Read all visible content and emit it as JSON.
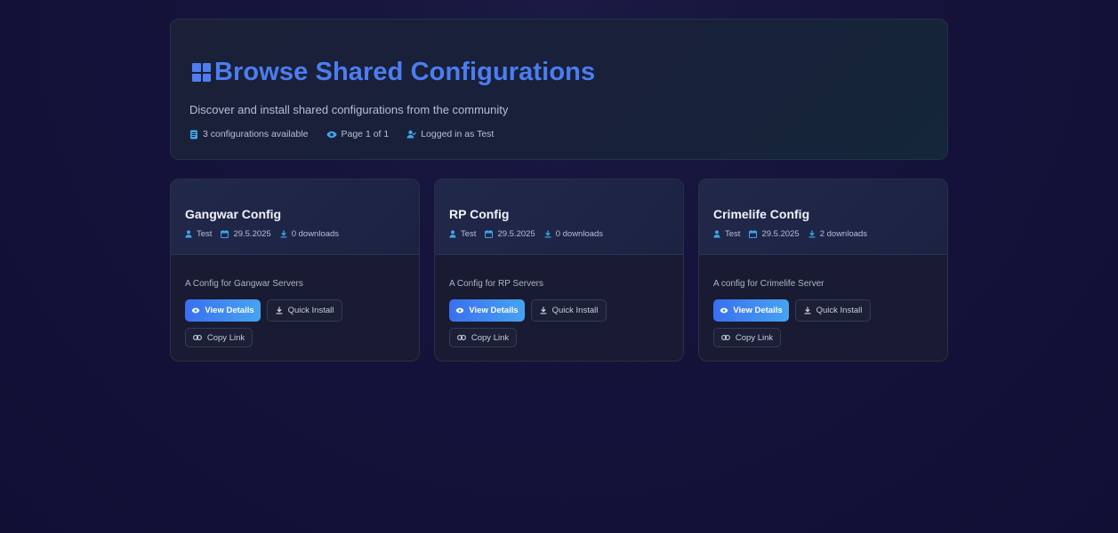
{
  "header": {
    "title": "Browse Shared Configurations",
    "subtitle": "Discover and install shared configurations from the community",
    "meta": {
      "count": "3 configurations available",
      "page": "Page 1 of 1",
      "user": "Logged in as Test"
    }
  },
  "colors": {
    "accent": "#4c7df0",
    "icon": "#3fa6e9",
    "background": "#14123a"
  },
  "cards": [
    {
      "title": "Gangwar Config",
      "author": "Test",
      "date": "29.5.2025",
      "downloads": "0 downloads",
      "description": "A Config for Gangwar Servers",
      "view_label": "View Details",
      "install_label": "Quick Install",
      "copy_label": "Copy Link"
    },
    {
      "title": "RP Config",
      "author": "Test",
      "date": "29.5.2025",
      "downloads": "0 downloads",
      "description": "A Config for RP Servers",
      "view_label": "View Details",
      "install_label": "Quick Install",
      "copy_label": "Copy Link"
    },
    {
      "title": "Crimelife Config",
      "author": "Test",
      "date": "29.5.2025",
      "downloads": "2 downloads",
      "description": "A config for Crimelife Server",
      "view_label": "View Details",
      "install_label": "Quick Install",
      "copy_label": "Copy Link"
    }
  ]
}
